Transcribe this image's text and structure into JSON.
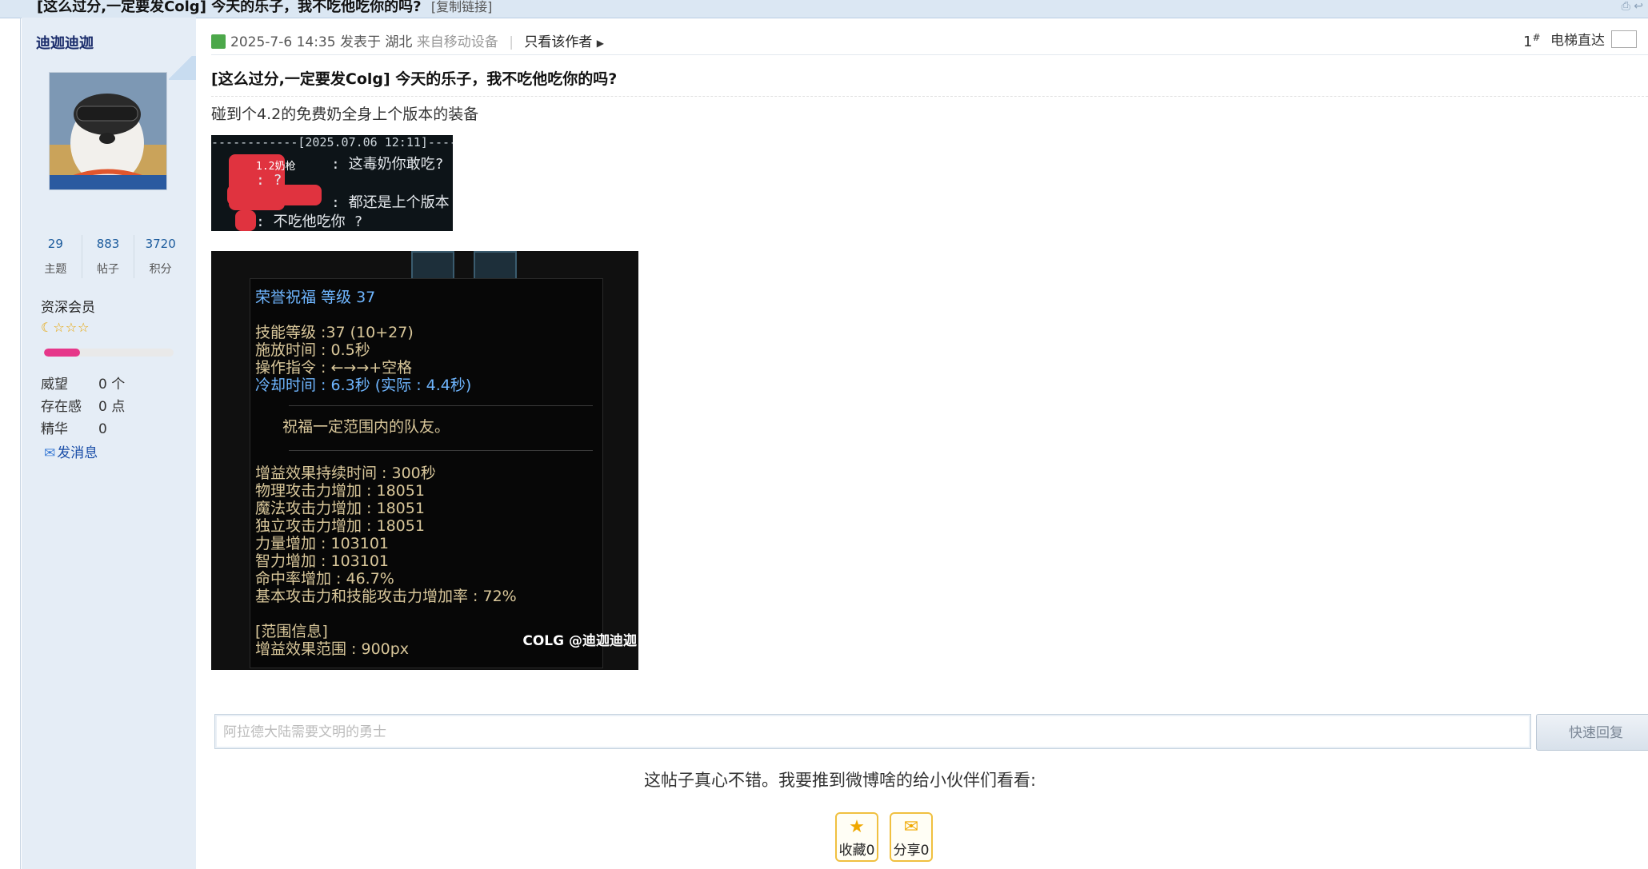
{
  "header": {
    "thread_title": "[这么过分,一定要发Colg] 今天的乐子，我不吃他吃你的吗?",
    "copy_link": "[复制链接]"
  },
  "author": {
    "name": "迪迦迪迦",
    "stats": [
      {
        "value": "29",
        "label": "主题"
      },
      {
        "value": "883",
        "label": "帖子"
      },
      {
        "value": "3720",
        "label": "积分"
      }
    ],
    "rank": "资深会员",
    "stars": "☾☆☆☆",
    "rank_progress_percent": 28,
    "info": [
      {
        "key": "威望",
        "value": "0 个"
      },
      {
        "key": "存在感",
        "value": "0 点"
      },
      {
        "key": "精华",
        "value": "0"
      }
    ],
    "send_message": "发消息"
  },
  "post": {
    "date": "2025-7-6 14:35",
    "posted_in": "发表于 湖北",
    "from_device": "来自移动设备",
    "only_author": "只看该作者",
    "floor": "1",
    "floor_sup": "#",
    "elevator": "电梯直达",
    "title": "[这么过分,一定要发Colg] 今天的乐子，我不吃他吃你的吗?",
    "text": "碰到个4.2的免费奶全身上个版本的装备"
  },
  "chat_image": {
    "date_line": "------------[2025.07.06 12:11]------",
    "tag": "1.2奶枪",
    "lines": [
      ": 这毒奶你敢吃?",
      ": ?",
      ": 都还是上个版本",
      ": 不吃他吃你 ?"
    ]
  },
  "skill_image": {
    "title": "荣誉祝福  等级 37",
    "lines": [
      "技能等级 :37 (10+27)",
      "施放时间 : 0.5秒",
      "操作指令 : ←→→+空格",
      "冷却时间 : 6.3秒 (实际 : 4.4秒)"
    ],
    "description": "祝福一定范围内的队友。",
    "effects": [
      "增益效果持续时间 : 300秒",
      "物理攻击力增加 : 18051",
      "魔法攻击力增加 : 18051",
      "独立攻击力增加 : 18051",
      "力量增加 : 103101",
      "智力增加 : 103101",
      "命中率增加 : 46.7%",
      "基本攻击力和技能攻击力增加率 : 72%"
    ],
    "range_header": "[范围信息]",
    "range_line": "增益效果范围 : 900px",
    "watermark": "COLG @迪迦迪迦"
  },
  "reply": {
    "placeholder": "阿拉德大陆需要文明的勇士",
    "button": "快速回复"
  },
  "share": {
    "prompt": "这帖子真心不错。我要推到微博啥的给小伙伴们看看:",
    "favorite": "收藏0",
    "share": "分享0"
  }
}
